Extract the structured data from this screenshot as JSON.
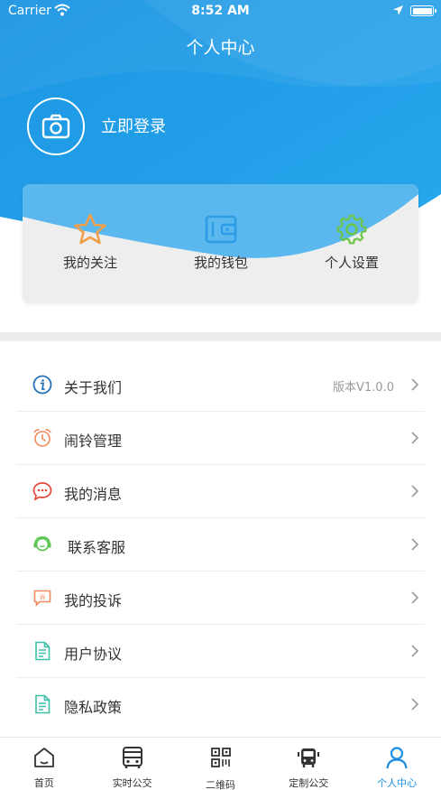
{
  "status_bar": {
    "carrier": "Carrier",
    "time": "8:52 AM"
  },
  "header": {
    "title": "个人中心"
  },
  "profile": {
    "login_label": "立即登录"
  },
  "quick_actions": [
    {
      "label": "我的关注",
      "icon": "star-icon",
      "color": "#f0a04b"
    },
    {
      "label": "我的钱包",
      "icon": "wallet-icon",
      "color": "#2d9be6"
    },
    {
      "label": "个人设置",
      "icon": "gear-icon",
      "color": "#6cc644"
    }
  ],
  "menu": [
    {
      "label": "关于我们",
      "icon": "info-icon",
      "extra": "版本V1.0.0"
    },
    {
      "label": "闹铃管理",
      "icon": "alarm-clock-icon"
    },
    {
      "label": "我的消息",
      "icon": "message-icon"
    },
    {
      "label": "联系客服",
      "icon": "customer-service-icon"
    },
    {
      "label": "我的投诉",
      "icon": "complaint-icon"
    },
    {
      "label": "用户协议",
      "icon": "document-icon"
    },
    {
      "label": "隐私政策",
      "icon": "document-icon"
    }
  ],
  "tabs": [
    {
      "label": "首页",
      "icon": "home-icon"
    },
    {
      "label": "实时公交",
      "icon": "bus-icon"
    },
    {
      "label": "二维码",
      "icon": "qr-code-icon"
    },
    {
      "label": "定制公交",
      "icon": "custom-bus-icon"
    },
    {
      "label": "个人中心",
      "icon": "user-icon",
      "active": true
    }
  ],
  "colors": {
    "header_blue": "#1e9be6",
    "active_tab": "#1a8fe3"
  }
}
